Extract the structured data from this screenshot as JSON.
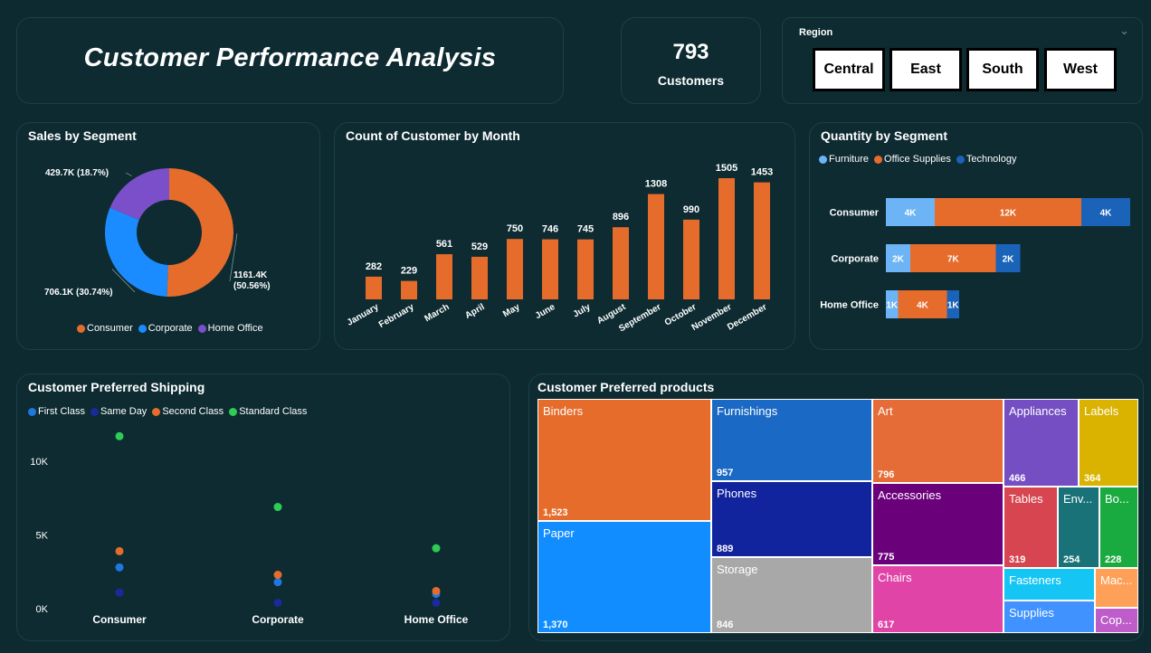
{
  "header": {
    "title": "Customer Performance Analysis"
  },
  "kpi": {
    "value": "793",
    "label": "Customers"
  },
  "region_slicer": {
    "title": "Region",
    "options": [
      "Central",
      "East",
      "South",
      "West"
    ]
  },
  "colors": {
    "background": "#0c2a30",
    "consumer": "#e66c2c",
    "corporate": "#1a8cff",
    "home_office": "#7b4fc9",
    "furniture": "#6cb4f5",
    "office_supplies": "#e66c2c",
    "technology": "#1a63b8",
    "first_class": "#1f77e0",
    "same_day": "#1a2a9c",
    "second_class": "#e66c2c",
    "standard_class": "#2ecc55"
  },
  "sales_by_segment": {
    "title": "Sales by Segment",
    "legend": [
      "Consumer",
      "Corporate",
      "Home Office"
    ],
    "chart_data": {
      "type": "pie",
      "categories": [
        "Consumer",
        "Corporate",
        "Home Office"
      ],
      "values": [
        1161.4,
        706.1,
        429.7
      ],
      "percent": [
        50.56,
        30.74,
        18.7
      ],
      "labels": [
        "1161.4K (50.56%)",
        "706.1K (30.74%)",
        "429.7K (18.7%)"
      ]
    }
  },
  "count_by_month": {
    "title": "Count of Customer by Month",
    "chart_data": {
      "type": "bar",
      "categories": [
        "January",
        "February",
        "March",
        "April",
        "May",
        "June",
        "July",
        "August",
        "September",
        "October",
        "November",
        "December"
      ],
      "values": [
        282,
        229,
        561,
        529,
        750,
        746,
        745,
        896,
        1308,
        990,
        1505,
        1453
      ]
    }
  },
  "quantity_by_segment": {
    "title": "Quantity by Segment",
    "legend": [
      "Furniture",
      "Office Supplies",
      "Technology"
    ],
    "chart_data": {
      "type": "bar",
      "orientation": "horizontal-stacked",
      "categories": [
        "Consumer",
        "Corporate",
        "Home Office"
      ],
      "series": [
        {
          "name": "Furniture",
          "values": [
            4,
            2,
            1
          ],
          "labels": [
            "4K",
            "2K",
            "1K"
          ]
        },
        {
          "name": "Office Supplies",
          "values": [
            12,
            7,
            4
          ],
          "labels": [
            "12K",
            "7K",
            "4K"
          ]
        },
        {
          "name": "Technology",
          "values": [
            4,
            2,
            1
          ],
          "labels": [
            "4K",
            "2K",
            "1K"
          ]
        }
      ]
    }
  },
  "preferred_shipping": {
    "title": "Customer Preferred Shipping",
    "legend": [
      "First Class",
      "Same Day",
      "Second Class",
      "Standard Class"
    ],
    "chart_data": {
      "type": "scatter",
      "categories": [
        "Consumer",
        "Corporate",
        "Home Office"
      ],
      "yticks": [
        "0K",
        "5K",
        "10K"
      ],
      "ylim": [
        0,
        12000
      ],
      "series": [
        {
          "name": "First Class",
          "values": [
            2800,
            1800,
            1000
          ]
        },
        {
          "name": "Same Day",
          "values": [
            1100,
            400,
            400
          ]
        },
        {
          "name": "Second Class",
          "values": [
            3900,
            2300,
            1200
          ]
        },
        {
          "name": "Standard Class",
          "values": [
            11700,
            6900,
            4100
          ]
        }
      ]
    }
  },
  "preferred_products": {
    "title": "Customer Preferred products",
    "chart_data": {
      "type": "treemap",
      "items": [
        {
          "label": "Binders",
          "value": "1,523",
          "color": "#e66c2c"
        },
        {
          "label": "Paper",
          "value": "1,370",
          "color": "#118dff"
        },
        {
          "label": "Furnishings",
          "value": "957",
          "color": "#1a69c4"
        },
        {
          "label": "Phones",
          "value": "889",
          "color": "#12239e"
        },
        {
          "label": "Storage",
          "value": "846",
          "color": "#a8a8a8"
        },
        {
          "label": "Art",
          "value": "796",
          "color": "#e66c37"
        },
        {
          "label": "Accessories",
          "value": "775",
          "color": "#6b007b"
        },
        {
          "label": "Chairs",
          "value": "617",
          "color": "#e044a7"
        },
        {
          "label": "Appliances",
          "value": "466",
          "color": "#744ec2"
        },
        {
          "label": "Labels",
          "value": "364",
          "color": "#d9b300"
        },
        {
          "label": "Tables",
          "value": "319",
          "color": "#d64550"
        },
        {
          "label": "Env...",
          "value": "254",
          "color": "#197278"
        },
        {
          "label": "Bo...",
          "value": "228",
          "color": "#1aab40"
        },
        {
          "label": "Fasteners",
          "value": "",
          "color": "#15c6f4"
        },
        {
          "label": "Supplies",
          "value": "",
          "color": "#4092ff"
        },
        {
          "label": "Mac...",
          "value": "",
          "color": "#ffa058"
        },
        {
          "label": "Cop...",
          "value": "",
          "color": "#be5dc9"
        }
      ]
    }
  }
}
